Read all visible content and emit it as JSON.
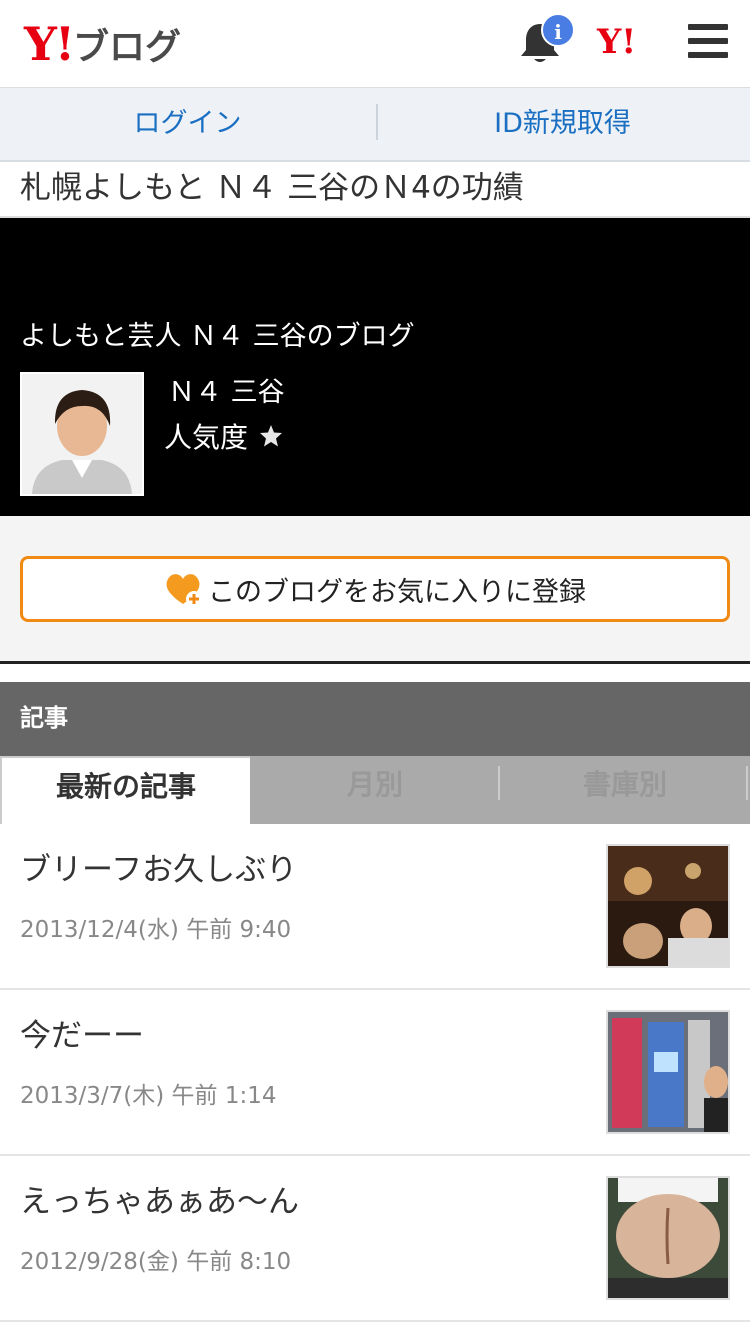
{
  "header": {
    "logo_mark": "Y!",
    "logo_text": "ブログ",
    "badge": "i",
    "yahoo_mark": "Y!"
  },
  "login_bar": {
    "login": "ログイン",
    "register": "ID新規取得"
  },
  "page_title": "札幌よしもと Ｎ４ 三谷のＮ4の功績",
  "profile": {
    "blog_name": "よしもと芸人 Ｎ４ 三谷のブログ",
    "author": "Ｎ４ 三谷",
    "popularity_label": "人気度"
  },
  "favorite_button": "このブログをお気に入りに登録",
  "section_title": "記事",
  "tabs": [
    {
      "label": "最新の記事"
    },
    {
      "label": "月別"
    },
    {
      "label": "書庫別"
    }
  ],
  "articles": [
    {
      "title": "ブリーフお久しぶり",
      "date": "2013/12/4(水) 午前 9:40"
    },
    {
      "title": "今だーー",
      "date": "2013/3/7(木) 午前 1:14"
    },
    {
      "title": "えっちゃあぁあ〜ん",
      "date": "2012/9/28(金) 午前 8:10"
    }
  ],
  "colors": {
    "brand_red": "#e60012",
    "link_blue": "#1a6fc2",
    "accent_orange": "#f08a14"
  }
}
